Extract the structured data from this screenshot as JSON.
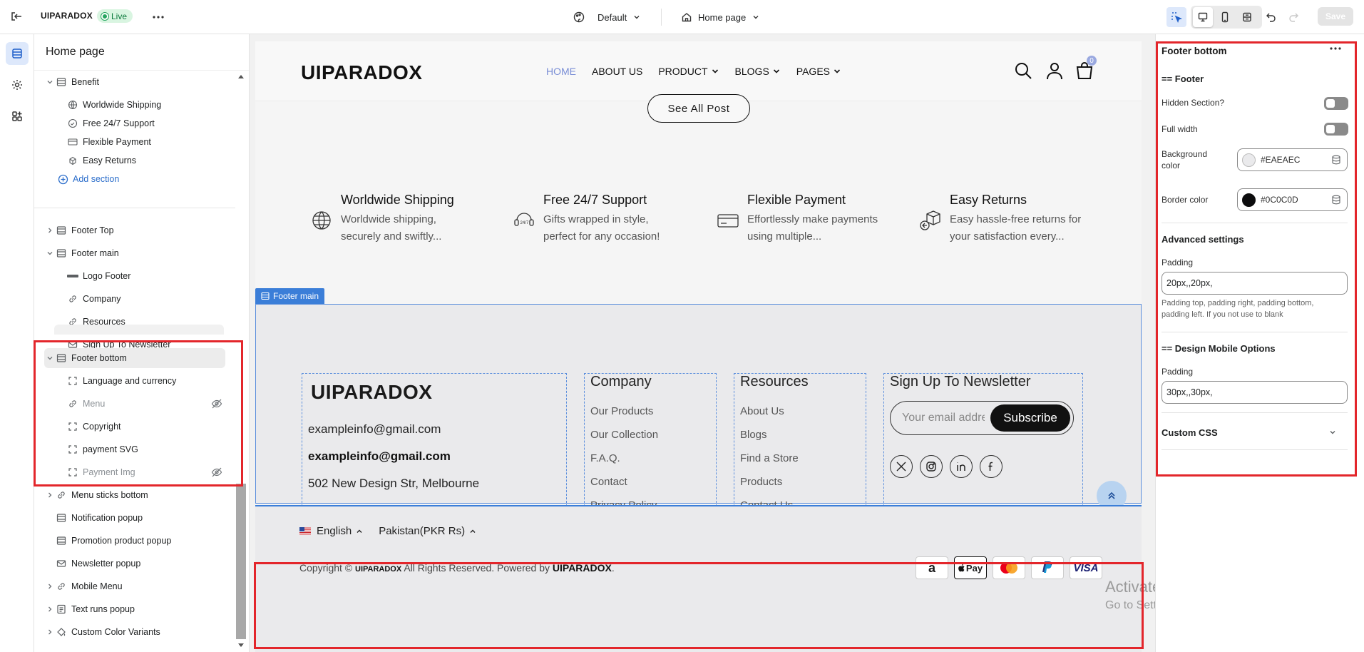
{
  "topbar": {
    "brand": "UIPARADOX",
    "live_badge": "Live",
    "theme_select": "Default",
    "page_select": "Home page",
    "save_label": "Save"
  },
  "left_panel": {
    "title": "Home page",
    "add_section": "Add section",
    "items": [
      {
        "label": "Benefit"
      },
      {
        "label": "Worldwide Shipping"
      },
      {
        "label": "Free 24/7 Support"
      },
      {
        "label": "Flexible Payment"
      },
      {
        "label": "Easy Returns"
      },
      {
        "label": "Footer Top"
      },
      {
        "label": "Footer main"
      },
      {
        "label": "Logo Footer"
      },
      {
        "label": "Company"
      },
      {
        "label": "Resources"
      },
      {
        "label": "Sign Up To Newsletter"
      },
      {
        "label": "Footer bottom"
      },
      {
        "label": "Language and currency"
      },
      {
        "label": "Menu"
      },
      {
        "label": "Copyright"
      },
      {
        "label": "payment SVG"
      },
      {
        "label": "Payment Img"
      },
      {
        "label": "Menu sticks bottom"
      },
      {
        "label": "Notification popup"
      },
      {
        "label": "Promotion product popup"
      },
      {
        "label": "Newsletter popup"
      },
      {
        "label": "Mobile Menu"
      },
      {
        "label": "Text runs popup"
      },
      {
        "label": "Custom Color Variants"
      }
    ]
  },
  "preview": {
    "logo": "UIPARADOX",
    "nav": [
      "HOME",
      "ABOUT US",
      "PRODUCT",
      "BLOGS",
      "PAGES"
    ],
    "cart_count": "0",
    "see_all": "See All Post",
    "benefits": [
      {
        "title": "Worldwide Shipping",
        "desc": "Worldwide shipping, securely and swiftly..."
      },
      {
        "title": "Free 24/7 Support",
        "desc": "Gifts wrapped in style, perfect for any occasion!"
      },
      {
        "title": "Flexible Payment",
        "desc": "Effortlessly make payments using multiple..."
      },
      {
        "title": "Easy Returns",
        "desc": "Easy hassle-free returns for your satisfaction every..."
      }
    ],
    "footer_main_tag": "Footer main",
    "footer_logo": "UIPARADOX",
    "contact": {
      "email1": "exampleinfo@gmail.com",
      "email2": "exampleinfo@gmail.com",
      "address": "502 New Design Str, Melbourne"
    },
    "company": {
      "heading": "Company",
      "links": [
        "Our Products",
        "Our Collection",
        "F.A.Q.",
        "Contact",
        "Privacy Policy"
      ]
    },
    "resources": {
      "heading": "Resources",
      "links": [
        "About Us",
        "Blogs",
        "Find a Store",
        "Products",
        "Contact Us"
      ]
    },
    "newsletter": {
      "heading": "Sign Up To Newsletter",
      "placeholder": "Your email address",
      "button": "Subscribe"
    },
    "language": "English",
    "currency": "Pakistan(PKR Rs)",
    "copyright_prefix": "Copyright ©",
    "copyright_brand": "UIPARADOX",
    "copyright_mid": "All Rights Reserved. Powered by",
    "copyright_powered": "UIPARADOX",
    "copyright_suffix": ".",
    "payments": [
      "a",
      "Pay",
      "mastercard",
      "paypal",
      "VISA"
    ]
  },
  "watermark": {
    "line1": "Activate Windows",
    "line2": "Go to Settings to activate Windows."
  },
  "right_panel": {
    "title": "Footer bottom",
    "section_footer": "== Footer",
    "hidden_section": "Hidden Section?",
    "full_width": "Full width",
    "background_color_label": "Background color",
    "background_color_value": "#EAEAEC",
    "border_color_label": "Border color",
    "border_color_value": "#0C0C0D",
    "advanced_settings": "Advanced settings",
    "padding_label": "Padding",
    "padding_value": "20px,,20px,",
    "padding_help": "Padding top, padding right, padding bottom, padding left. If you not use to blank",
    "design_mobile": "== Design Mobile Options",
    "mobile_padding_label": "Padding",
    "mobile_padding_value": "30px,,30px,",
    "custom_css": "Custom CSS"
  }
}
